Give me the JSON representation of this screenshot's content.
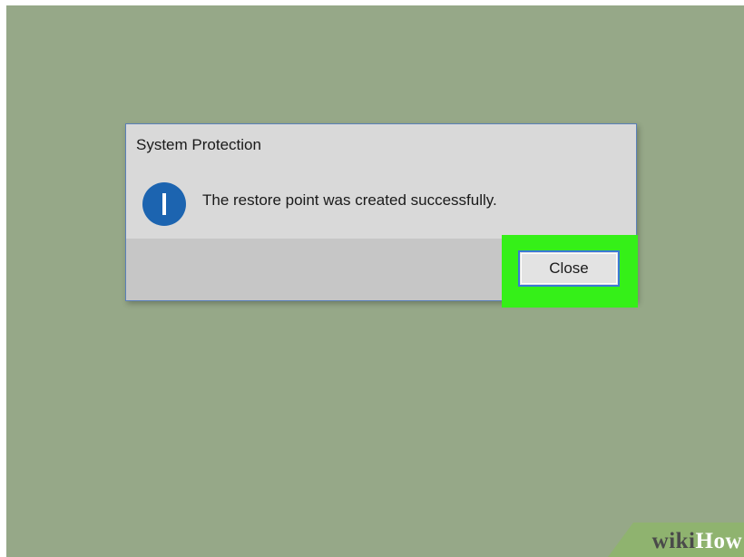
{
  "colors": {
    "desktop_background": "#96a888",
    "dialog_background": "#d9d9d9",
    "footer_background": "#c6c6c6",
    "highlight": "#35f018",
    "info_icon": "#1c64b0",
    "button_border": "#3a78d6"
  },
  "dialog": {
    "title": "System Protection",
    "icon": "info-icon",
    "message": "The restore point was created successfully.",
    "close_label": "Close"
  },
  "watermark": {
    "part1": "wiki",
    "part2": "How"
  }
}
